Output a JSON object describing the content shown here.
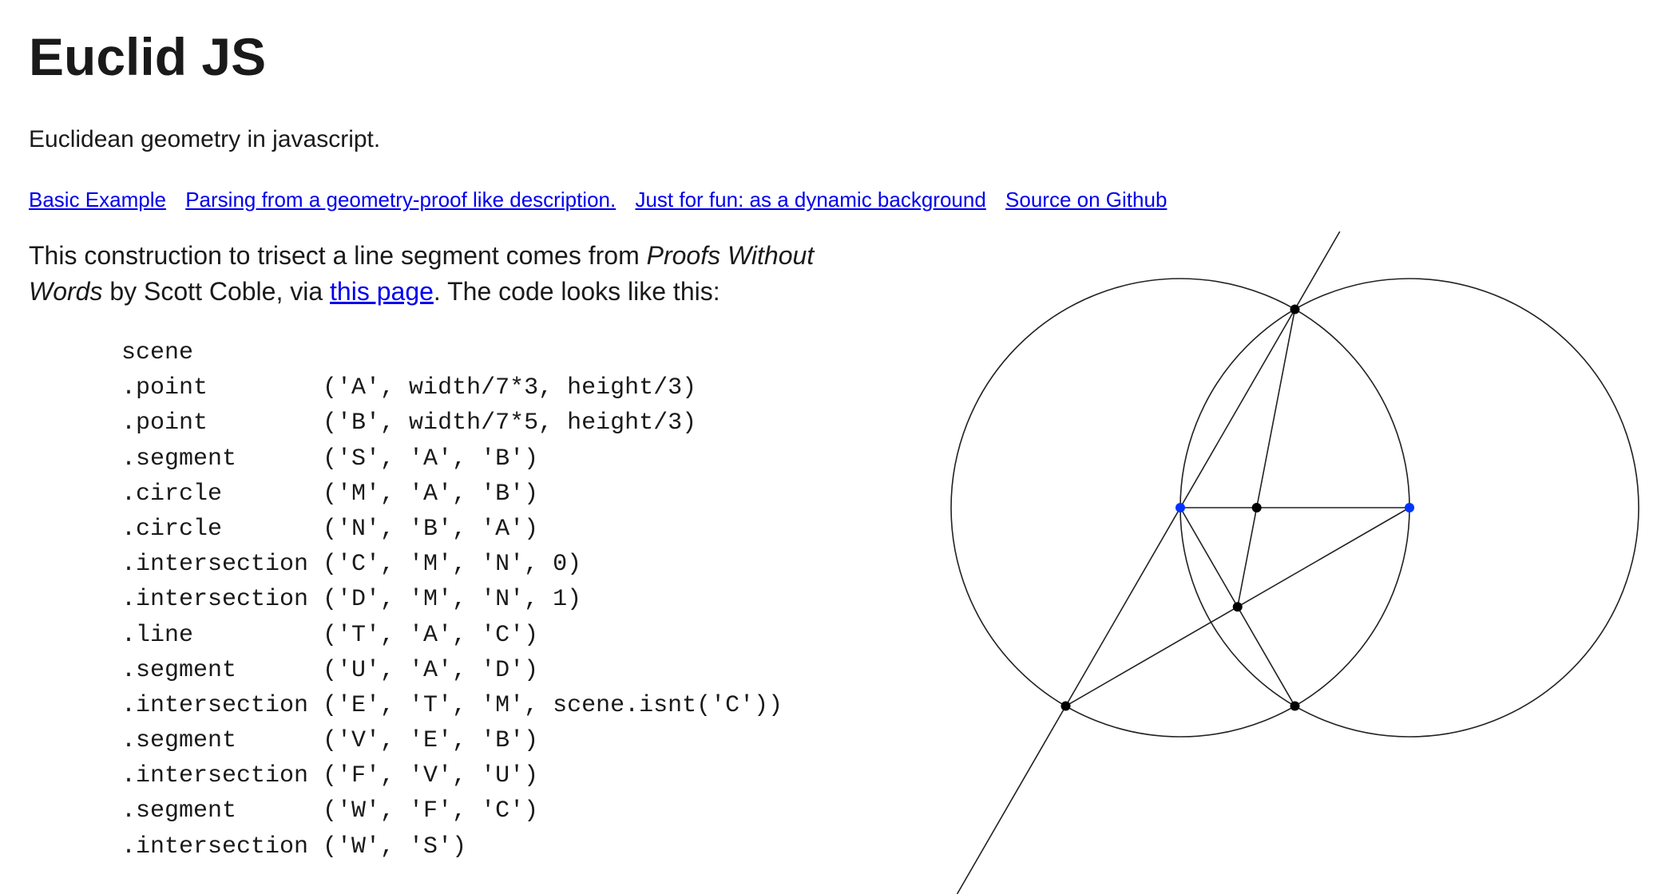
{
  "page": {
    "title": "Euclid JS",
    "tagline": "Euclidean geometry in javascript.",
    "links": [
      "Basic Example",
      "Parsing from a geometry-proof like description.",
      "Just for fun: as a dynamic background",
      "Source on Github"
    ],
    "intro": {
      "part1": "This construction to trisect a line segment comes from ",
      "book": "Proofs Without Words",
      "part2": " by Scott Coble, via ",
      "link": "this page",
      "part3": ". The code looks like this:"
    },
    "code": [
      "scene",
      ".point        ('A', width/7*3, height/3)",
      ".point        ('B', width/7*5, height/3)",
      ".segment      ('S', 'A', 'B')",
      ".circle       ('M', 'A', 'B')",
      ".circle       ('N', 'B', 'A')",
      ".intersection ('C', 'M', 'N', 0)",
      ".intersection ('D', 'M', 'N', 1)",
      ".line         ('T', 'A', 'C')",
      ".segment      ('U', 'A', 'D')",
      ".intersection ('E', 'T', 'M', scene.isnt('C'))",
      ".segment      ('V', 'E', 'B')",
      ".intersection ('F', 'V', 'U')",
      ".segment      ('W', 'F', 'C')",
      ".intersection ('W', 'S')"
    ]
  },
  "colors": {
    "text": "#1a1a1a",
    "link": "#0000ee",
    "free_point": "#0033ff",
    "derived_point": "#000000",
    "stroke": "#222222"
  }
}
